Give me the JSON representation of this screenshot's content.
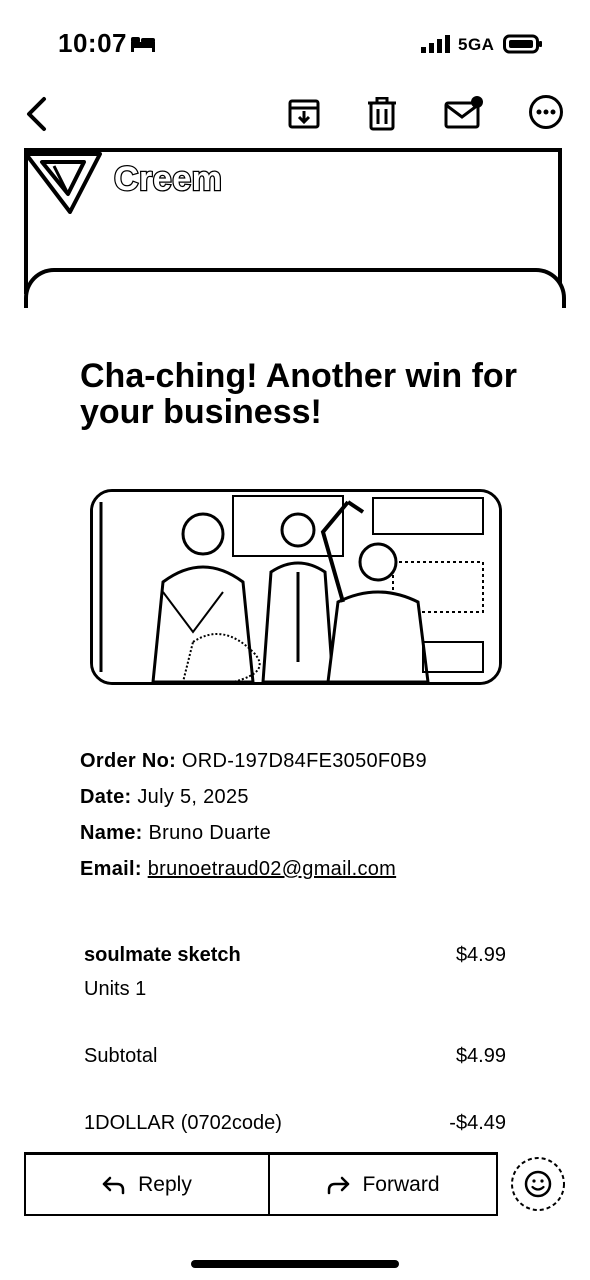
{
  "status_bar": {
    "time": "10:07",
    "network": "5GA",
    "icons": [
      "bed-icon",
      "signal-icon",
      "battery-icon"
    ]
  },
  "toolbar": {
    "icons": [
      "back-chevron-icon",
      "archive-icon",
      "trash-icon",
      "mark-unread-icon",
      "more-icon"
    ]
  },
  "email": {
    "brand_name": "Creem",
    "headline": "Cha-ching! Another win for your business!",
    "order": {
      "order_no_label": "Order No:",
      "order_no_value": "ORD-197D84FE3050F0B9",
      "date_label": "Date:",
      "date_value": "July 5, 2025",
      "name_label": "Name:",
      "name_value": "Bruno Duarte",
      "email_label": "Email:",
      "email_value": "brunoetraud02@gmail.com"
    },
    "items": {
      "product_name": "soulmate sketch",
      "product_price": "$4.99",
      "units_label": "Units 1",
      "subtotal_label": "Subtotal",
      "subtotal_value": "$4.99",
      "discount_label": "1DOLLAR (0702code)",
      "discount_value": "-$4.49"
    }
  },
  "actions": {
    "reply_label": "Reply",
    "forward_label": "Forward",
    "icons": [
      "reply-arrow-icon",
      "forward-arrow-icon",
      "emoji-icon"
    ]
  },
  "colors": {
    "foreground": "#000000",
    "background": "#ffffff"
  }
}
